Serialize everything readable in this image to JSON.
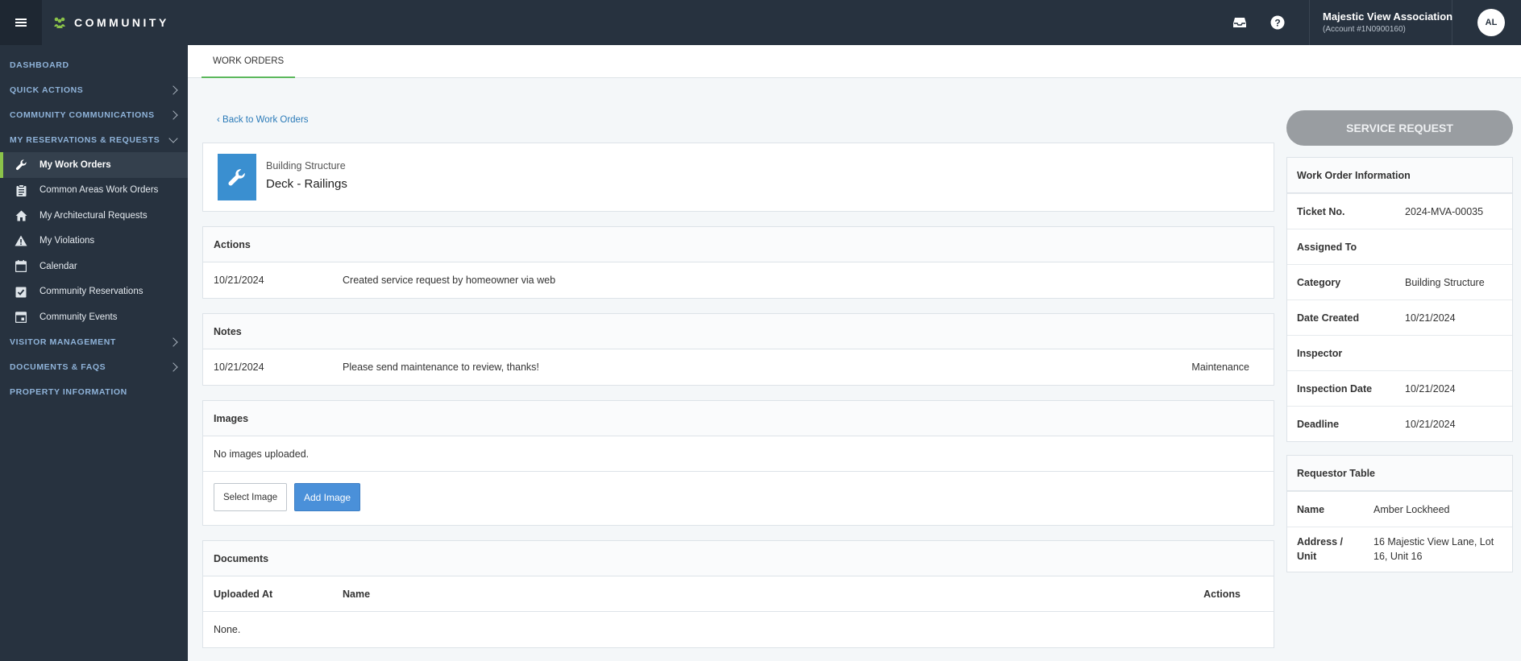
{
  "brand": {
    "name": "COMMUNITY"
  },
  "account": {
    "name": "Majestic View Association",
    "number": "(Account #1N0900160)"
  },
  "user": {
    "initials": "AL"
  },
  "icons": {
    "inbox": "inbox-icon",
    "help": "help-icon",
    "menu": "hamburger-icon"
  },
  "colors": {
    "accent_green": "#8bc34a",
    "primary_blue": "#4a90d9",
    "sidebar_bg": "#27323f"
  },
  "sidebar": {
    "dashboard": "DASHBOARD",
    "quick_actions": "QUICK ACTIONS",
    "community_communications": "COMMUNITY COMMUNICATIONS",
    "my_reservations": "MY RESERVATIONS & REQUESTS",
    "items": [
      {
        "label": "My Work Orders",
        "icon": "wrench-icon"
      },
      {
        "label": "Common Areas Work Orders",
        "icon": "clipboard-icon"
      },
      {
        "label": "My Architectural Requests",
        "icon": "home-icon"
      },
      {
        "label": "My Violations",
        "icon": "warning-icon"
      },
      {
        "label": "Calendar",
        "icon": "calendar-icon"
      },
      {
        "label": "Community Reservations",
        "icon": "checklist-icon"
      },
      {
        "label": "Community Events",
        "icon": "event-icon"
      }
    ],
    "visitor_management": "VISITOR MANAGEMENT",
    "documents_faqs": "DOCUMENTS & FAQS",
    "property_information": "PROPERTY INFORMATION"
  },
  "tabs": {
    "work_orders": "WORK ORDERS"
  },
  "back_link": "‹ Back to Work Orders",
  "work_order": {
    "category": "Building Structure",
    "title": "Deck - Railings"
  },
  "actions": {
    "heading": "Actions",
    "rows": [
      {
        "date": "10/21/2024",
        "description": "Created service request by homeowner via web"
      }
    ]
  },
  "notes": {
    "heading": "Notes",
    "rows": [
      {
        "date": "10/21/2024",
        "text": "Please send maintenance to review, thanks!",
        "author": "Maintenance"
      }
    ]
  },
  "images": {
    "heading": "Images",
    "empty_text": "No images uploaded.",
    "select_label": "Select Image",
    "add_label": "Add Image"
  },
  "documents": {
    "heading": "Documents",
    "columns": {
      "uploaded_at": "Uploaded At",
      "name": "Name",
      "actions": "Actions"
    },
    "empty_text": "None."
  },
  "service_request_label": "SERVICE REQUEST",
  "work_order_info": {
    "heading": "Work Order Information",
    "fields": [
      {
        "label": "Ticket No.",
        "value": "2024-MVA-00035"
      },
      {
        "label": "Assigned To",
        "value": ""
      },
      {
        "label": "Category",
        "value": "Building Structure"
      },
      {
        "label": "Date Created",
        "value": "10/21/2024"
      },
      {
        "label": "Inspector",
        "value": ""
      },
      {
        "label": "Inspection Date",
        "value": "10/21/2024"
      },
      {
        "label": "Deadline",
        "value": "10/21/2024"
      }
    ]
  },
  "requestor": {
    "heading": "Requestor Table",
    "name_label": "Name",
    "name_value": "Amber Lockheed",
    "address_label": "Address / Unit",
    "address_value": "16 Majestic View Lane, Lot 16, Unit 16"
  }
}
